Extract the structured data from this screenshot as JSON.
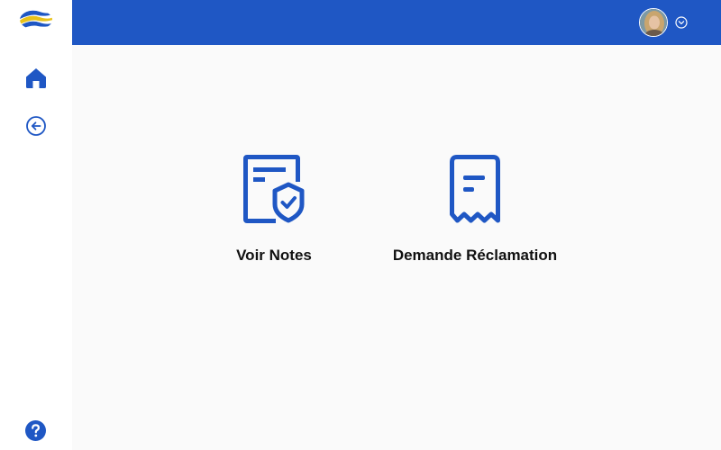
{
  "colors": {
    "accent": "#1f57c4",
    "logo_yellow": "#e8c21a",
    "background": "#fafafa",
    "sidebar": "#ffffff",
    "text": "#111111"
  },
  "sidebar": {
    "logo_icon": "brand-logo-icon",
    "items": [
      {
        "icon": "home-icon"
      },
      {
        "icon": "back-arrow-circle-icon"
      }
    ],
    "help_icon": "question-circle-icon"
  },
  "header": {
    "avatar_icon": "user-avatar",
    "menu_icon": "chevron-down-circle-icon"
  },
  "main": {
    "cards": [
      {
        "label": "Voir Notes",
        "icon": "document-shield-check-icon"
      },
      {
        "label": "Demande Réclamation",
        "icon": "receipt-icon"
      }
    ]
  }
}
